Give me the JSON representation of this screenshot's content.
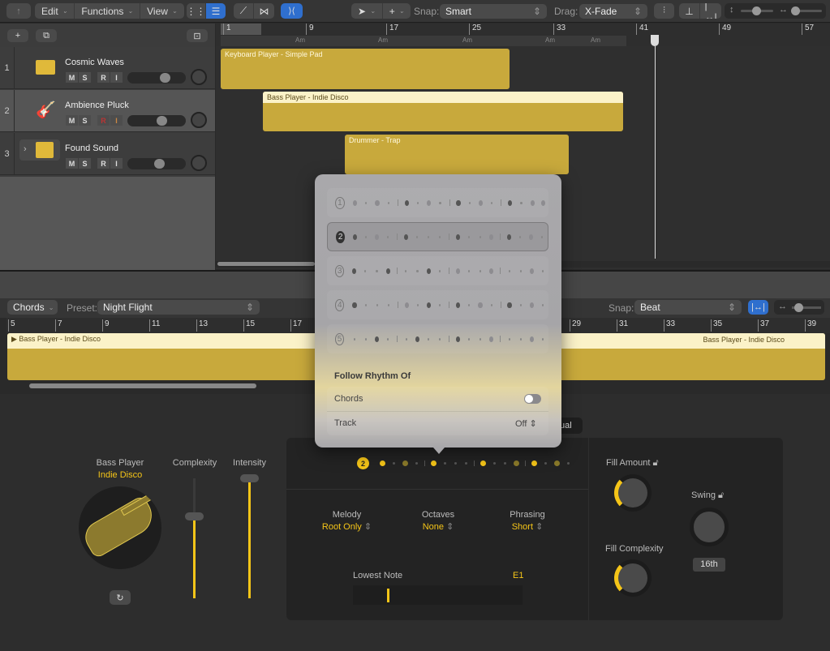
{
  "toolbar": {
    "menus": [
      "Edit",
      "Functions",
      "View"
    ],
    "snap_label": "Snap:",
    "snap_value": "Smart",
    "drag_label": "Drag:",
    "drag_value": "X-Fade"
  },
  "ruler": {
    "bars": [
      "1",
      "9",
      "17",
      "25",
      "33",
      "41",
      "49",
      "57"
    ],
    "chord_marker": "Am"
  },
  "tracks": [
    {
      "number": "1",
      "name": "Cosmic Waves",
      "icon": "keyboard-icon",
      "buttons": [
        "M",
        "S",
        "R",
        "I"
      ]
    },
    {
      "number": "2",
      "name": "Ambience Pluck",
      "icon": "guitar-icon",
      "buttons": [
        "M",
        "S",
        "R",
        "I"
      ]
    },
    {
      "number": "3",
      "name": "Found Sound",
      "icon": "drum-machine-icon",
      "buttons": [
        "M",
        "S",
        "R",
        "I"
      ]
    }
  ],
  "regions": [
    {
      "name": "Keyboard Player - Simple Pad"
    },
    {
      "name": "Bass Player - Indie Disco"
    },
    {
      "name": "Drummer - Trap"
    }
  ],
  "editor": {
    "view_selector": "Chords",
    "preset_label": "Preset:",
    "preset_value": "Night Flight",
    "snap_label": "Snap:",
    "snap_value": "Beat",
    "ruler_bars": [
      "5",
      "7",
      "9",
      "11",
      "13",
      "15",
      "17",
      "29",
      "31",
      "33",
      "35",
      "37",
      "39"
    ],
    "region_name": "Bass Player - Indie Disco"
  },
  "popover": {
    "patterns": [
      "1",
      "2",
      "3",
      "4",
      "5"
    ],
    "selected_pattern": "2",
    "follow_title": "Follow Rhythm Of",
    "chords_label": "Chords",
    "chords_toggle": "off",
    "track_label": "Track",
    "track_value": "Off"
  },
  "player": {
    "label": "Bass Player",
    "style": "Indie Disco",
    "complexity_label": "Complexity",
    "complexity_value": 0.67,
    "intensity_label": "Intensity",
    "intensity_value": 1.0,
    "manual_partial": "ual",
    "selected_pattern_badge": "2",
    "melody_label": "Melody",
    "melody_value": "Root Only",
    "octaves_label": "Octaves",
    "octaves_value": "None",
    "phrasing_label": "Phrasing",
    "phrasing_value": "Short",
    "lowest_note_label": "Lowest Note",
    "lowest_note_value": "E1",
    "fill_amount_label": "Fill Amount",
    "fill_complexity_label": "Fill Complexity",
    "swing_label": "Swing",
    "swing_value": "16th"
  }
}
